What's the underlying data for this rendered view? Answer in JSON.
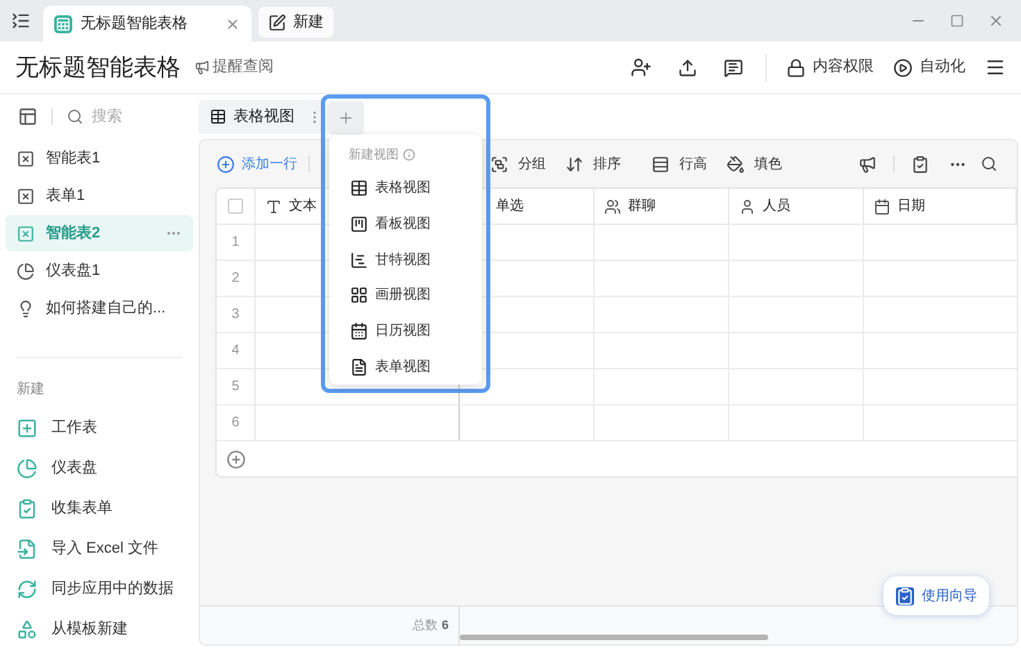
{
  "window": {
    "tabs": [
      {
        "label": "无标题智能表格",
        "selected": true,
        "closable": true
      },
      {
        "label": "新建",
        "selected": false,
        "closable": false
      }
    ]
  },
  "header": {
    "title": "无标题智能表格",
    "remind": "提醒查阅",
    "actions": [
      {
        "label": "内容权限",
        "kind": "lock"
      },
      {
        "label": "自动化",
        "kind": "play"
      }
    ]
  },
  "sidebar": {
    "search": {
      "placeholder": "搜索"
    },
    "items": [
      {
        "label": "智能表1",
        "kind": "sheet",
        "selected": false
      },
      {
        "label": "表单1",
        "kind": "sheet",
        "selected": false
      },
      {
        "label": "智能表2",
        "kind": "sheet",
        "selected": true
      },
      {
        "label": "仪表盘1",
        "kind": "dashboard",
        "selected": false
      },
      {
        "label": "如何搭建自己的...",
        "kind": "tip",
        "selected": false
      }
    ],
    "new_section": {
      "title": "新建",
      "items": [
        {
          "label": "工作表",
          "kind": "sheet"
        },
        {
          "label": "仪表盘",
          "kind": "dashboard"
        },
        {
          "label": "收集表单",
          "kind": "form"
        },
        {
          "label": "导入 Excel 文件",
          "kind": "import"
        },
        {
          "label": "同步应用中的数据",
          "kind": "sync"
        },
        {
          "label": "从模板新建",
          "kind": "template"
        }
      ]
    }
  },
  "view_tabs": [
    {
      "label": "表格视图",
      "selected": true
    }
  ],
  "toolbar": {
    "add_row": "添加一行",
    "items": [
      {
        "label": "分组",
        "kind": "group"
      },
      {
        "label": "排序",
        "kind": "sort"
      },
      {
        "label": "行高",
        "kind": "height"
      },
      {
        "label": "填色",
        "kind": "fill"
      }
    ]
  },
  "table": {
    "columns": [
      {
        "label": "文本",
        "kind": "text"
      },
      {
        "label": "单选",
        "kind": "select"
      },
      {
        "label": "群聊",
        "kind": "chat"
      },
      {
        "label": "人员",
        "kind": "person"
      },
      {
        "label": "日期",
        "kind": "date"
      }
    ],
    "select_all_checked": false,
    "rows": [
      "1",
      "2",
      "3",
      "4",
      "5",
      "6"
    ],
    "footer": {
      "total_label": "总数",
      "total": "6"
    }
  },
  "new_view_menu": {
    "title": "新建视图",
    "items": [
      {
        "label": "表格视图",
        "kind": "grid"
      },
      {
        "label": "看板视图",
        "kind": "kanban"
      },
      {
        "label": "甘特视图",
        "kind": "gantt"
      },
      {
        "label": "画册视图",
        "kind": "gallery"
      },
      {
        "label": "日历视图",
        "kind": "calendar"
      },
      {
        "label": "表单视图",
        "kind": "form"
      }
    ]
  },
  "guide_button": "使用向导"
}
